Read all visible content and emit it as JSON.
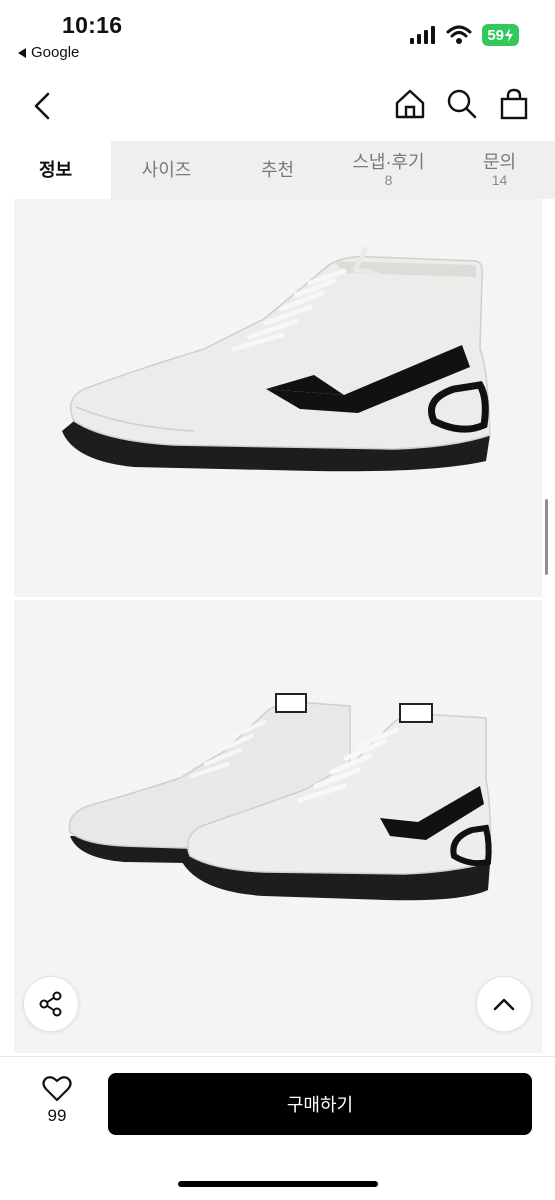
{
  "status_bar": {
    "time": "10:16",
    "back_app": "Google",
    "battery": "59"
  },
  "nav": {
    "back": "back-icon",
    "icons": [
      "home-icon",
      "search-icon",
      "shopping-bag-icon"
    ]
  },
  "tabs": [
    {
      "label": "정보",
      "count": ""
    },
    {
      "label": "사이즈",
      "count": ""
    },
    {
      "label": "추천",
      "count": ""
    },
    {
      "label": "스냅·후기",
      "count": "8"
    },
    {
      "label": "문의",
      "count": "14"
    }
  ],
  "gallery": {
    "images": [
      "white-high-top-boxing-shoe-side-view",
      "pair-of-white-high-top-boxing-shoes"
    ]
  },
  "floating": {
    "share": "share-icon",
    "scroll_top": "chevron-up-icon"
  },
  "bottom_bar": {
    "like_count": "99",
    "buy_label": "구매하기"
  },
  "colors": {
    "active_tab_bg": "#ffffff",
    "tab_bar_bg": "#efefef",
    "buy_button": "#000000",
    "battery": "#34c759"
  }
}
